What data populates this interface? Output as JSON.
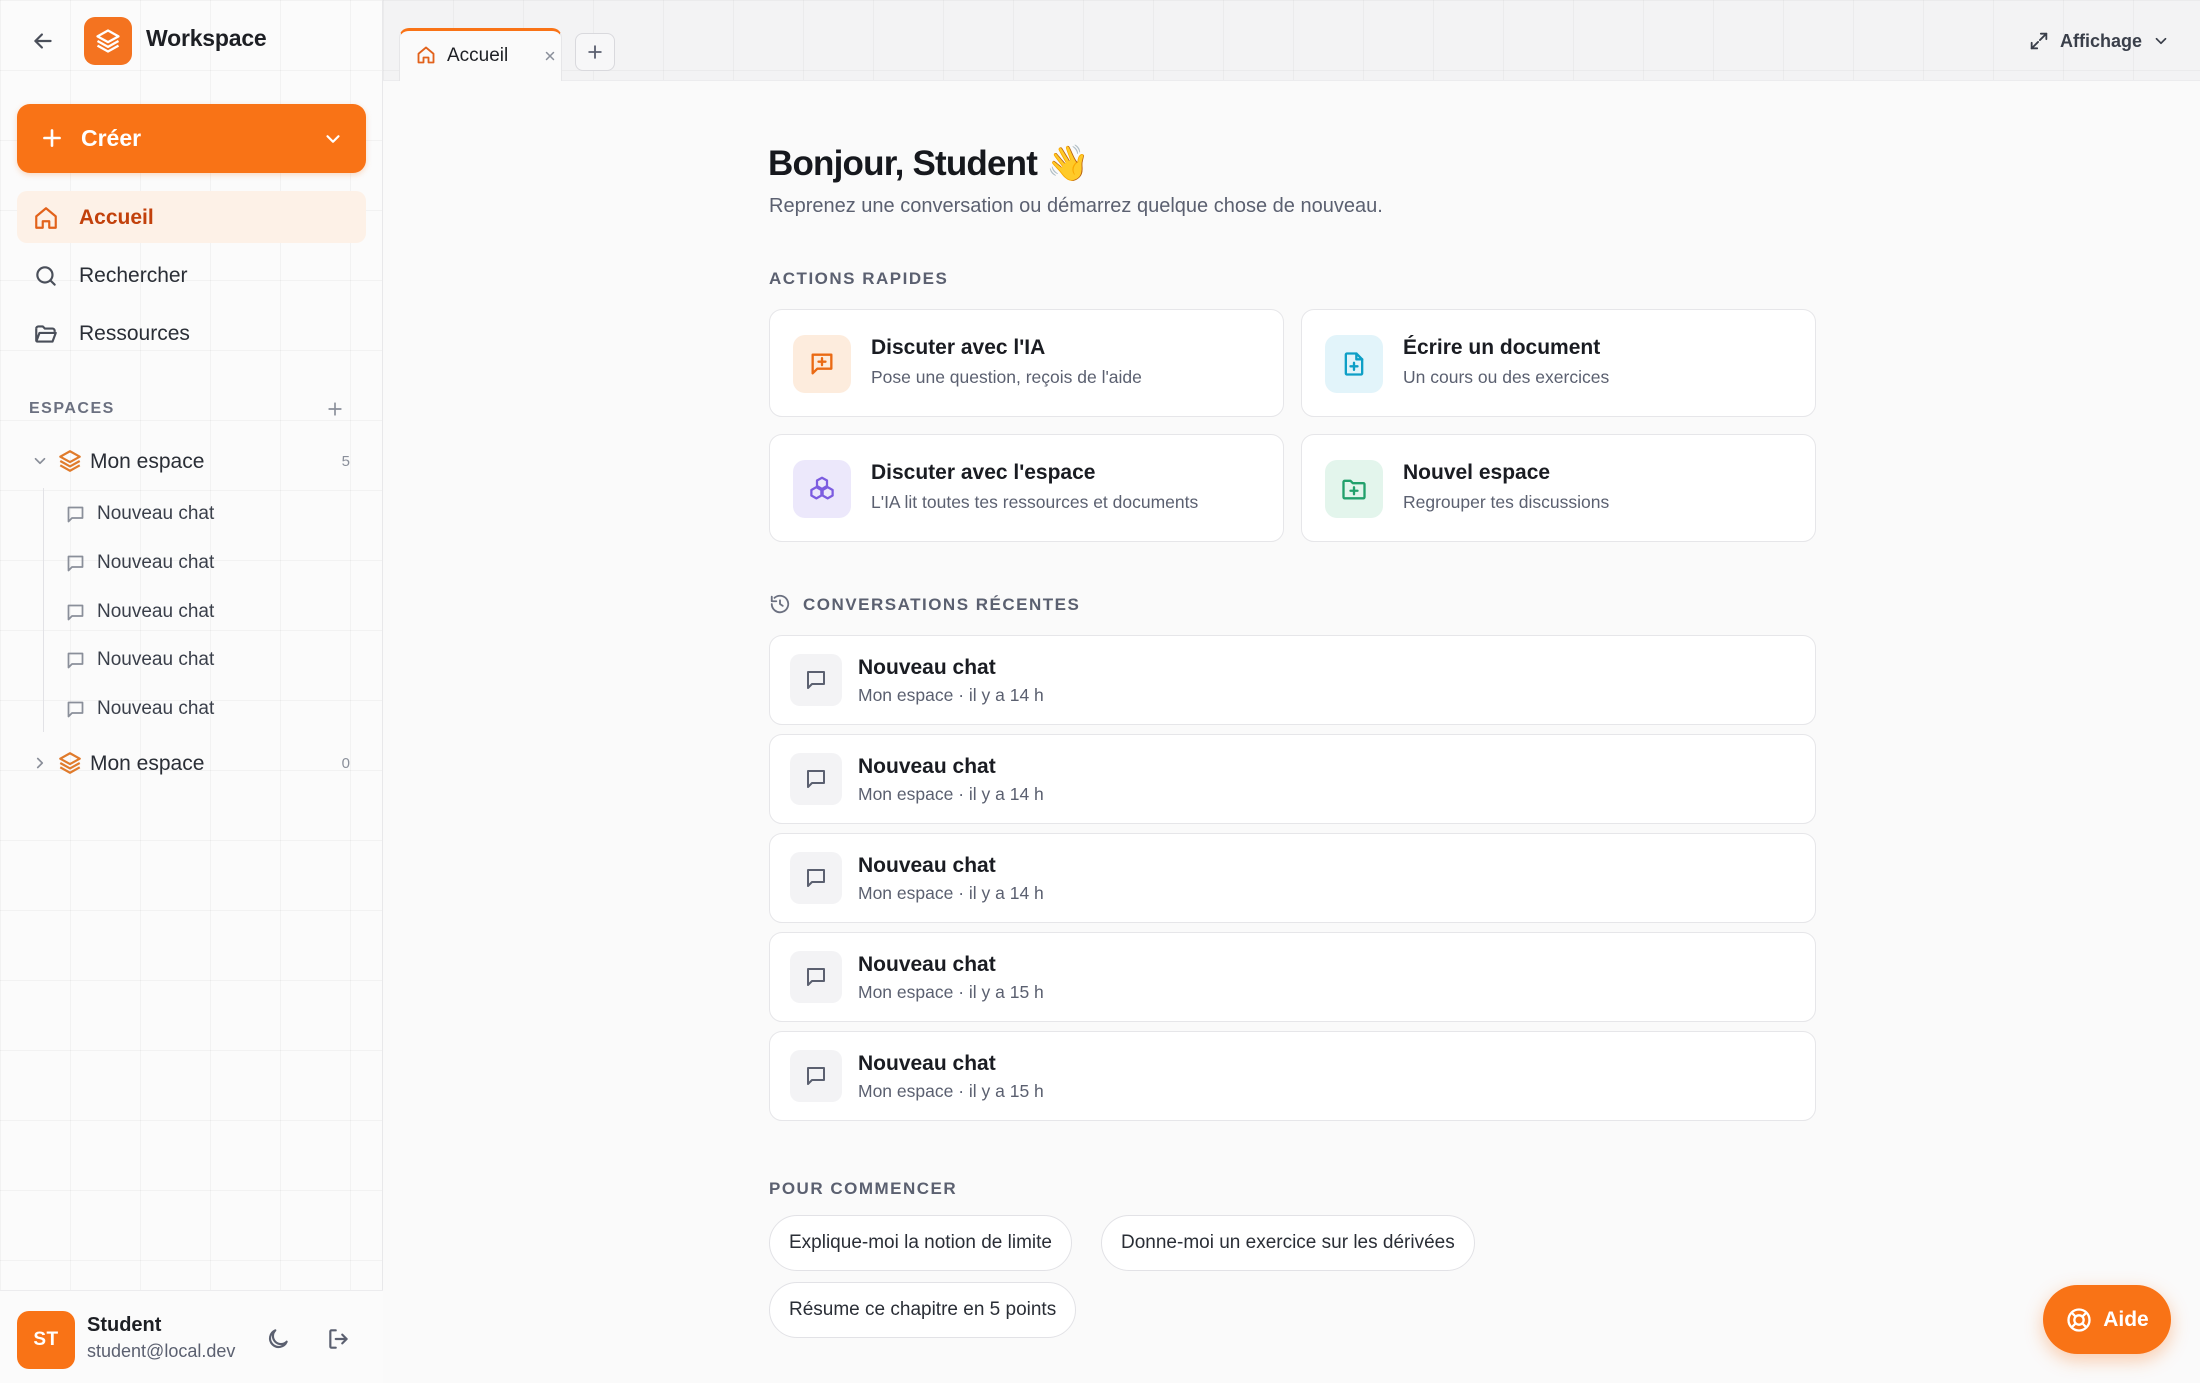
{
  "app": {
    "title": "Workspace"
  },
  "sidebar": {
    "create_label": "Créer",
    "nav": [
      {
        "label": "Accueil",
        "icon": "home-icon",
        "active": true
      },
      {
        "label": "Rechercher",
        "icon": "search-icon",
        "active": false
      },
      {
        "label": "Ressources",
        "icon": "folder-icon",
        "active": false
      }
    ],
    "spaces_header": "ESPACES",
    "spaces": [
      {
        "name": "Mon espace",
        "count": "5",
        "expanded": true,
        "chats": [
          "Nouveau chat",
          "Nouveau chat",
          "Nouveau chat",
          "Nouveau chat",
          "Nouveau chat"
        ]
      },
      {
        "name": "Mon espace",
        "count": "0",
        "expanded": false,
        "chats": []
      }
    ],
    "user": {
      "initials": "ST",
      "name": "Student",
      "email": "student@local.dev"
    }
  },
  "tabs": [
    {
      "label": "Accueil",
      "icon": "home-icon"
    }
  ],
  "topbar": {
    "view_label": "Affichage"
  },
  "main": {
    "greeting": "Bonjour, Student 👋",
    "subtitle": "Reprenez une conversation ou démarrez quelque chose de nouveau.",
    "quick_actions_title": "ACTIONS RAPIDES",
    "quick_actions": [
      {
        "title": "Discuter avec l'IA",
        "desc": "Pose une question, reçois de l'aide",
        "icon": "chat-plus-icon",
        "color": "#f97316"
      },
      {
        "title": "Écrire un document",
        "desc": "Un cours ou des exercices",
        "icon": "file-plus-icon",
        "color": "#0ea5c9"
      },
      {
        "title": "Discuter avec l'espace",
        "desc": "L'IA lit toutes tes ressources et documents",
        "icon": "boxes-icon",
        "color": "#7c5ce0"
      },
      {
        "title": "Nouvel espace",
        "desc": "Regrouper tes discussions",
        "icon": "folder-plus-icon",
        "color": "#22a06b"
      }
    ],
    "recent_title": "CONVERSATIONS RÉCENTES",
    "recent": [
      {
        "title": "Nouveau chat",
        "meta": "Mon espace · il y a 14 h"
      },
      {
        "title": "Nouveau chat",
        "meta": "Mon espace · il y a 14 h"
      },
      {
        "title": "Nouveau chat",
        "meta": "Mon espace · il y a 14 h"
      },
      {
        "title": "Nouveau chat",
        "meta": "Mon espace · il y a 15 h"
      },
      {
        "title": "Nouveau chat",
        "meta": "Mon espace · il y a 15 h"
      }
    ],
    "start_title": "POUR COMMENCER",
    "suggestions": [
      "Explique-moi la notion de limite",
      "Donne-moi un exercice sur les dérivées",
      "Résume ce chapitre en 5 points"
    ]
  },
  "help": {
    "label": "Aide"
  },
  "colors": {
    "accent": "#f97316",
    "accent_dark": "#c2410c"
  }
}
